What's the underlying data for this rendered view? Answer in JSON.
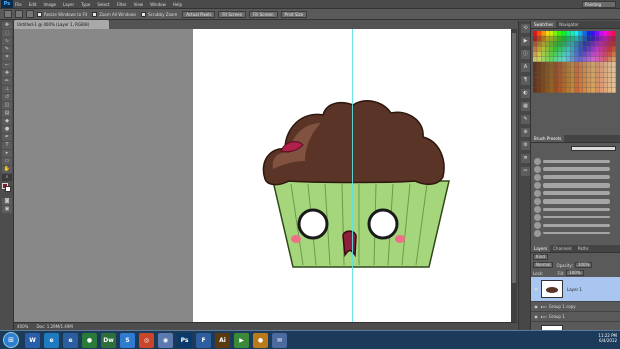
{
  "app": {
    "logo": "Ps",
    "menu": [
      "File",
      "Edit",
      "Image",
      "Layer",
      "Type",
      "Select",
      "Filter",
      "View",
      "Window",
      "Help"
    ],
    "workspace_mode": "Painting"
  },
  "options_bar": {
    "checkboxes": [
      "Resize Windows to Fit",
      "Zoom All Windows",
      "Scrubby Zoom"
    ],
    "buttons": [
      "Actual Pixels",
      "Fit Screen",
      "Fill Screen",
      "Print Size"
    ]
  },
  "document": {
    "tab_title": "Untitled-1 @ 400% (Layer 1, RGB/8)",
    "zoom": "400%",
    "doc_size": "Doc: 1.29M/1.49M"
  },
  "colors": {
    "fg": "#7d1d2d",
    "bg": "#ffffff",
    "canvas_bg": "#888888",
    "guide": "#5fe0e8"
  },
  "swatches_panel": {
    "tabs": [
      "Swatches",
      "Navigator"
    ]
  },
  "brush_panel": {
    "tabs": [
      "Brush Presets"
    ]
  },
  "layers_panel": {
    "tabs": [
      "Layers",
      "Channels",
      "Paths"
    ],
    "kind_select": "Kind",
    "blend_mode": "Normal",
    "opacity_label": "Opacity:",
    "opacity": "100%",
    "lock_label": "Lock:",
    "fill_label": "Fill:",
    "fill": "100%",
    "layers": [
      {
        "name": "Layer 1",
        "selected": true
      },
      {
        "name": "Group 1 copy",
        "selected": false
      },
      {
        "name": "Group 1",
        "selected": false
      },
      {
        "name": "Background",
        "selected": false
      }
    ]
  },
  "taskbar": {
    "start": "⊞",
    "apps": [
      {
        "label": "W",
        "color": "#2b5ea8",
        "name": "word"
      },
      {
        "label": "e",
        "color": "#1f7ac0",
        "name": "ie"
      },
      {
        "label": "e",
        "color": "#2a5e9e",
        "name": "ie2"
      },
      {
        "label": "●",
        "color": "#2a7a3a",
        "name": "media"
      },
      {
        "label": "Dw",
        "color": "#2d6e3a",
        "name": "dreamweaver"
      },
      {
        "label": "S",
        "color": "#2f7bd0",
        "name": "skype"
      },
      {
        "label": "◎",
        "color": "#c9462a",
        "name": "chrome"
      },
      {
        "label": "◉",
        "color": "#5a7ab0",
        "name": "app7"
      },
      {
        "label": "Ps",
        "color": "#0a3a6a",
        "name": "photoshop"
      },
      {
        "label": "F",
        "color": "#2d5ea0",
        "name": "filezilla"
      },
      {
        "label": "Ai",
        "color": "#5a3a12",
        "name": "illustrator"
      },
      {
        "label": "▶",
        "color": "#3a8a3a",
        "name": "player"
      },
      {
        "label": "●",
        "color": "#b87a1a",
        "name": "app12"
      },
      {
        "label": "✉",
        "color": "#4a6aa0",
        "name": "mail"
      }
    ],
    "time": "11:22 PM",
    "date": "6/4/2012"
  }
}
